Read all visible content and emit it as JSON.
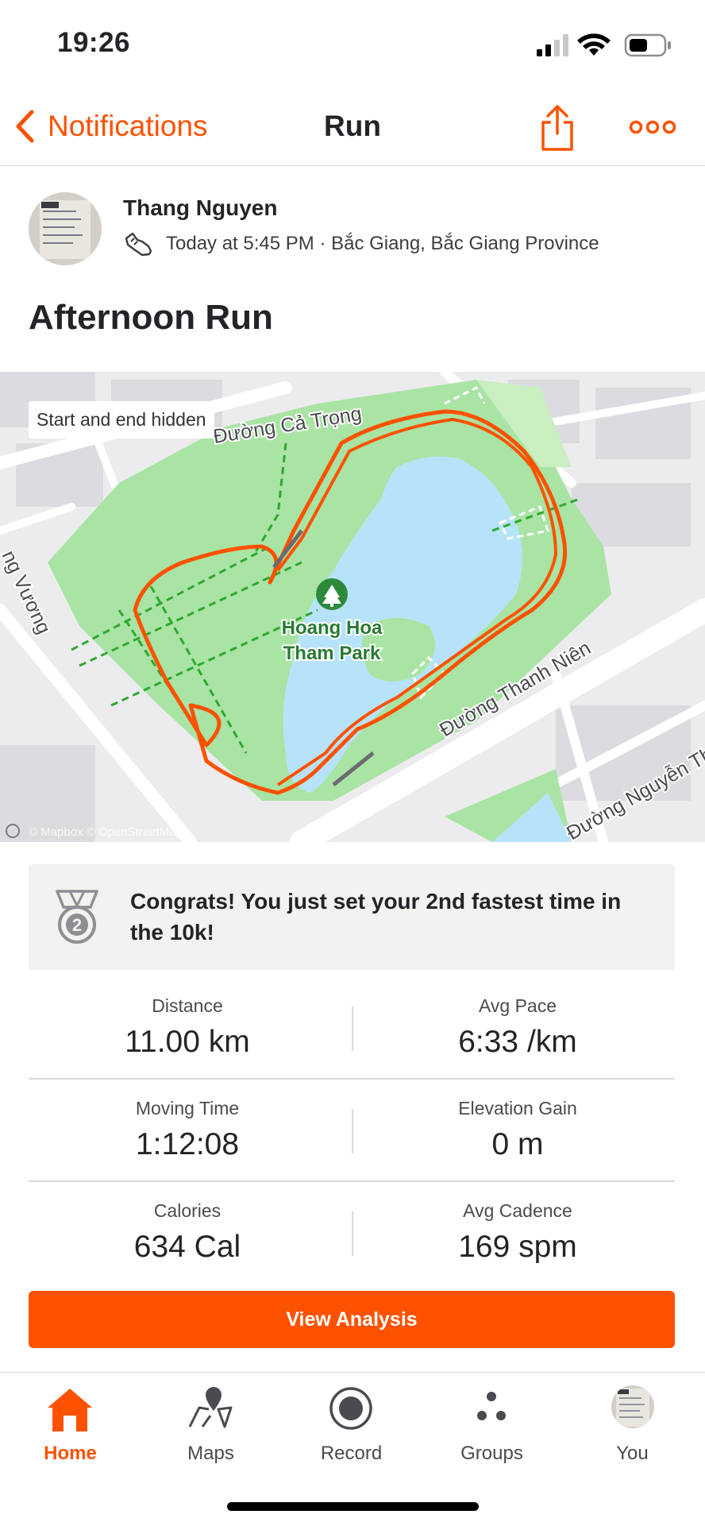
{
  "status_bar": {
    "time": "19:26"
  },
  "nav": {
    "back_label": "Notifications",
    "title": "Run"
  },
  "activity": {
    "athlete_name": "Thang Nguyen",
    "meta": "Today at 5:45 PM · Bắc Giang, Bắc Giang Province",
    "title": "Afternoon Run"
  },
  "map": {
    "privacy_label": "Start and end hidden",
    "park_name_line1": "Hoang Hoa",
    "park_name_line2": "Tham Park",
    "street_1": "Đường Cả Trọng",
    "street_2": "Đường Thanh Niên",
    "street_3": "Đường Nguyễn Th",
    "street_4": "ng Vương",
    "attribution": "© Mapbox © OpenStreetMap"
  },
  "achievement": {
    "rank": "2",
    "text": "Congrats! You just set your 2nd fastest time in the 10k!"
  },
  "stats": [
    {
      "label": "Distance",
      "value": "11.00 km"
    },
    {
      "label": "Avg Pace",
      "value": "6:33 /km"
    },
    {
      "label": "Moving Time",
      "value": "1:12:08"
    },
    {
      "label": "Elevation Gain",
      "value": "0 m"
    },
    {
      "label": "Calories",
      "value": "634 Cal"
    },
    {
      "label": "Avg Cadence",
      "value": "169 spm"
    }
  ],
  "actions": {
    "view_analysis": "View Analysis"
  },
  "tabs": [
    {
      "label": "Home",
      "icon": "home-icon",
      "active": true
    },
    {
      "label": "Maps",
      "icon": "map-pin-icon",
      "active": false
    },
    {
      "label": "Record",
      "icon": "record-icon",
      "active": false
    },
    {
      "label": "Groups",
      "icon": "groups-icon",
      "active": false
    },
    {
      "label": "You",
      "icon": "profile-avatar",
      "active": false
    }
  ],
  "colors": {
    "accent": "#fc5200",
    "route": "#fc5200",
    "water": "#b7e3fa",
    "park": "#a9e4a4"
  }
}
